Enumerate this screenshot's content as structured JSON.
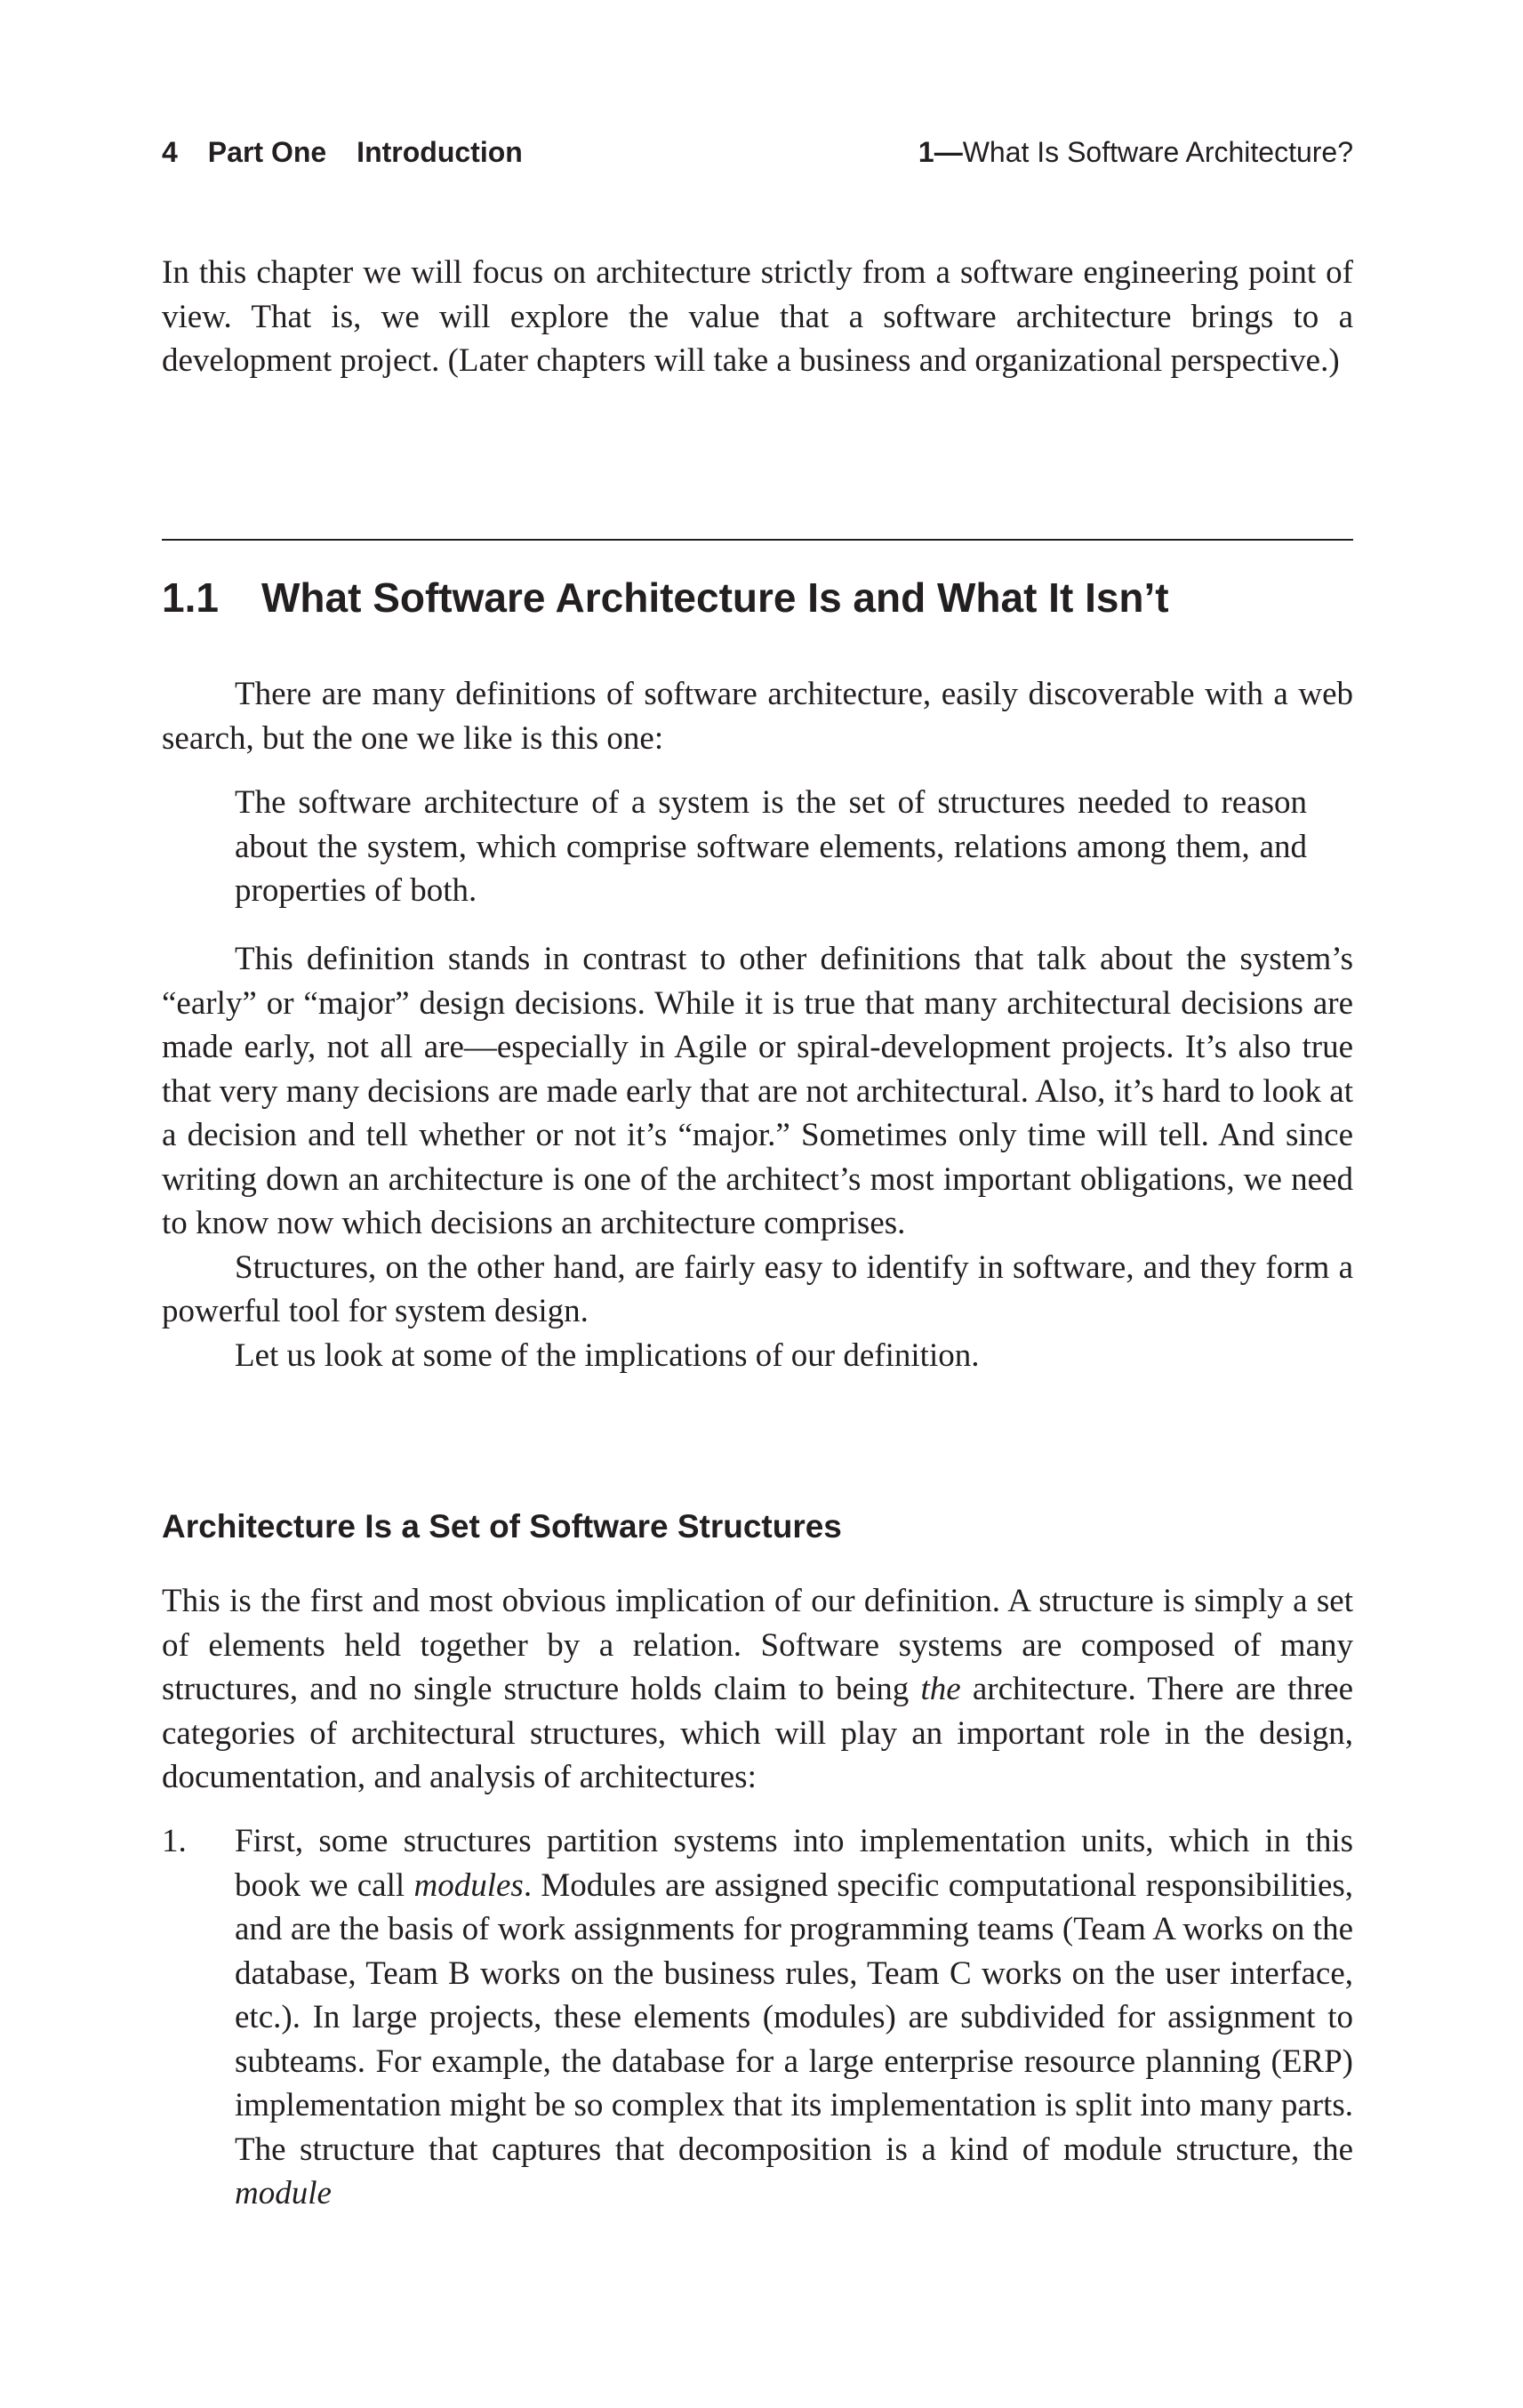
{
  "running_head": {
    "page_number": "4",
    "part": "Part One",
    "part_title": "Introduction",
    "chapter_number": "1",
    "chapter_sep": "—",
    "chapter_title": "What Is Software Architecture?"
  },
  "intro_paragraph": "In this chapter we will focus on architecture strictly from a software engineering point of view. That is, we will explore the value that a software architecture brings to a development project. (Later chapters will take a business and organizational perspective.)",
  "section": {
    "number": "1.1",
    "title": "What Software Architecture Is and What It Isn’t"
  },
  "p_definitions": "There are many definitions of software architecture, easily discoverable with a web search, but the one we like is this one:",
  "definition_quote": "The software architecture of a system is the set of structures needed to reason about the system, which comprise software elements, relations among them, and properties of both.",
  "p_contrast": "This definition stands in contrast to other definitions that talk about the system’s “early” or “major” design decisions. While it is true that many architectural decisions are made early, not all are—especially in Agile or spiral-development projects. It’s also true that very many decisions are made early that are not architectural. Also, it’s hard to look at a decision and tell whether or not it’s “major.” Sometimes only time will tell. And since writing down an architecture is one of the architect’s most important obligations, we need to know now which decisions an architecture comprises.",
  "p_structures": "Structures, on the other hand, are fairly easy to identify in software, and they form a powerful tool for system design.",
  "p_implications": "Let us look at some of the implications of our definition.",
  "subsection_title": "Architecture Is a Set of Software Structures",
  "p_sub": {
    "before_em": "This is the first and most obvious implication of our definition. A structure is simply a set of elements held together by a relation. Software systems are composed of many structures, and no single structure holds claim to being ",
    "em": "the",
    "after_em": " architecture. There are three categories of architectural structures, which will play an important role in the design, documentation, and analysis of architectures:"
  },
  "list_item_1": {
    "number": "1.",
    "before_em": "First, some structures partition systems into implementation units, which in this book we call ",
    "em": "modules",
    "middle": ". Modules are assigned specific computational responsibilities, and are the basis of work assignments for programming teams (Team A works on the database, Team B works on the business rules, Team C works on the user interface, etc.). In large projects, these elements (modules) are subdivided for assignment to subteams. For example, the database for a large enterprise resource planning (ERP) implementation might be so complex that its implementation is split into many parts. The structure that captures that decomposition is a kind of module structure, the ",
    "em2": "module"
  }
}
